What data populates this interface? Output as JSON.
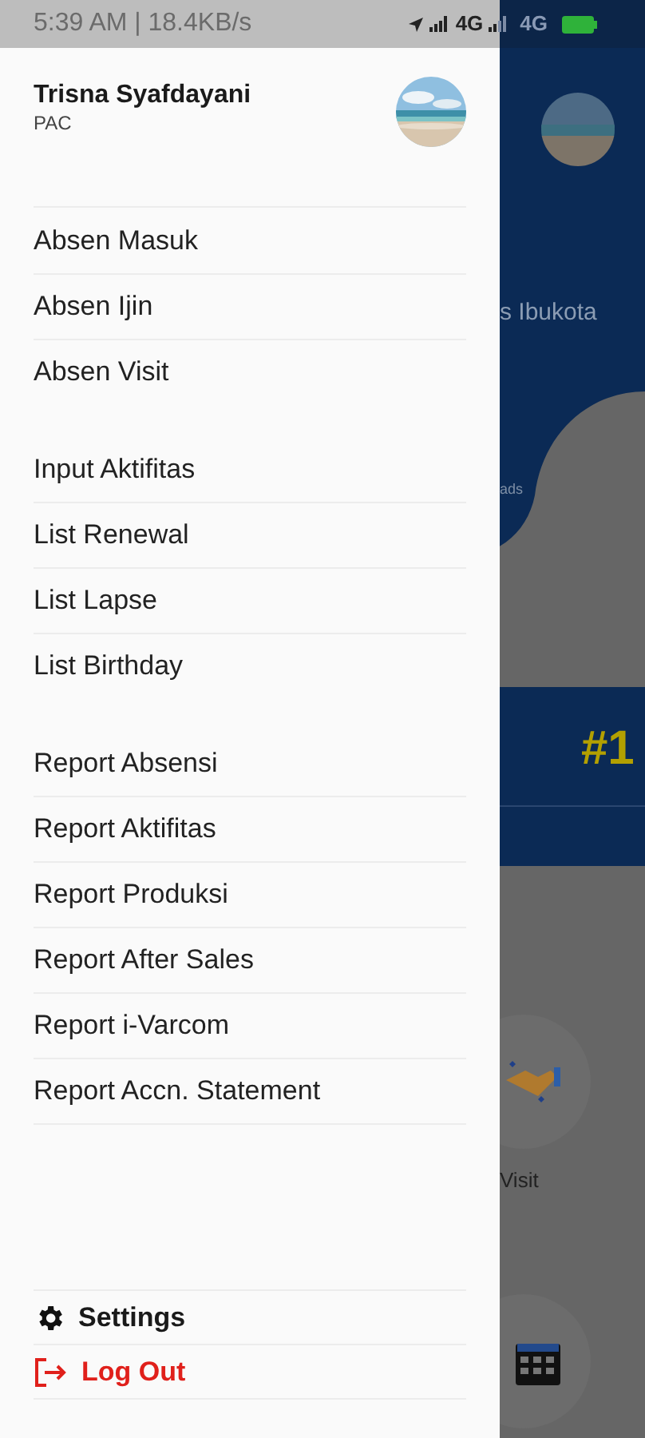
{
  "status_bar": {
    "time_speed": "5:39 AM | 18.4KB/s",
    "network_1": "4G",
    "network_2": "4G"
  },
  "drawer": {
    "user": {
      "name": "Trisna Syafdayani",
      "role": "PAC"
    },
    "menu_groups": [
      {
        "items": [
          "Absen Masuk",
          "Absen Ijin",
          "Absen Visit"
        ]
      },
      {
        "items": [
          "Input Aktifitas",
          "List Renewal",
          "List Lapse",
          "List Birthday"
        ]
      },
      {
        "items": [
          "Report Absensi",
          "Report Aktifitas",
          "Report Produksi",
          "Report After Sales",
          "Report i-Varcom",
          "Report Accn. Statement"
        ]
      }
    ],
    "footer": [
      {
        "label": "Settings",
        "kind": "settings"
      },
      {
        "label": "Log Out",
        "kind": "logout"
      }
    ]
  },
  "background_screen": {
    "banner_text": "s Ibukota",
    "card_label": "ads",
    "rank": "#1",
    "menu_label": "Visit"
  }
}
